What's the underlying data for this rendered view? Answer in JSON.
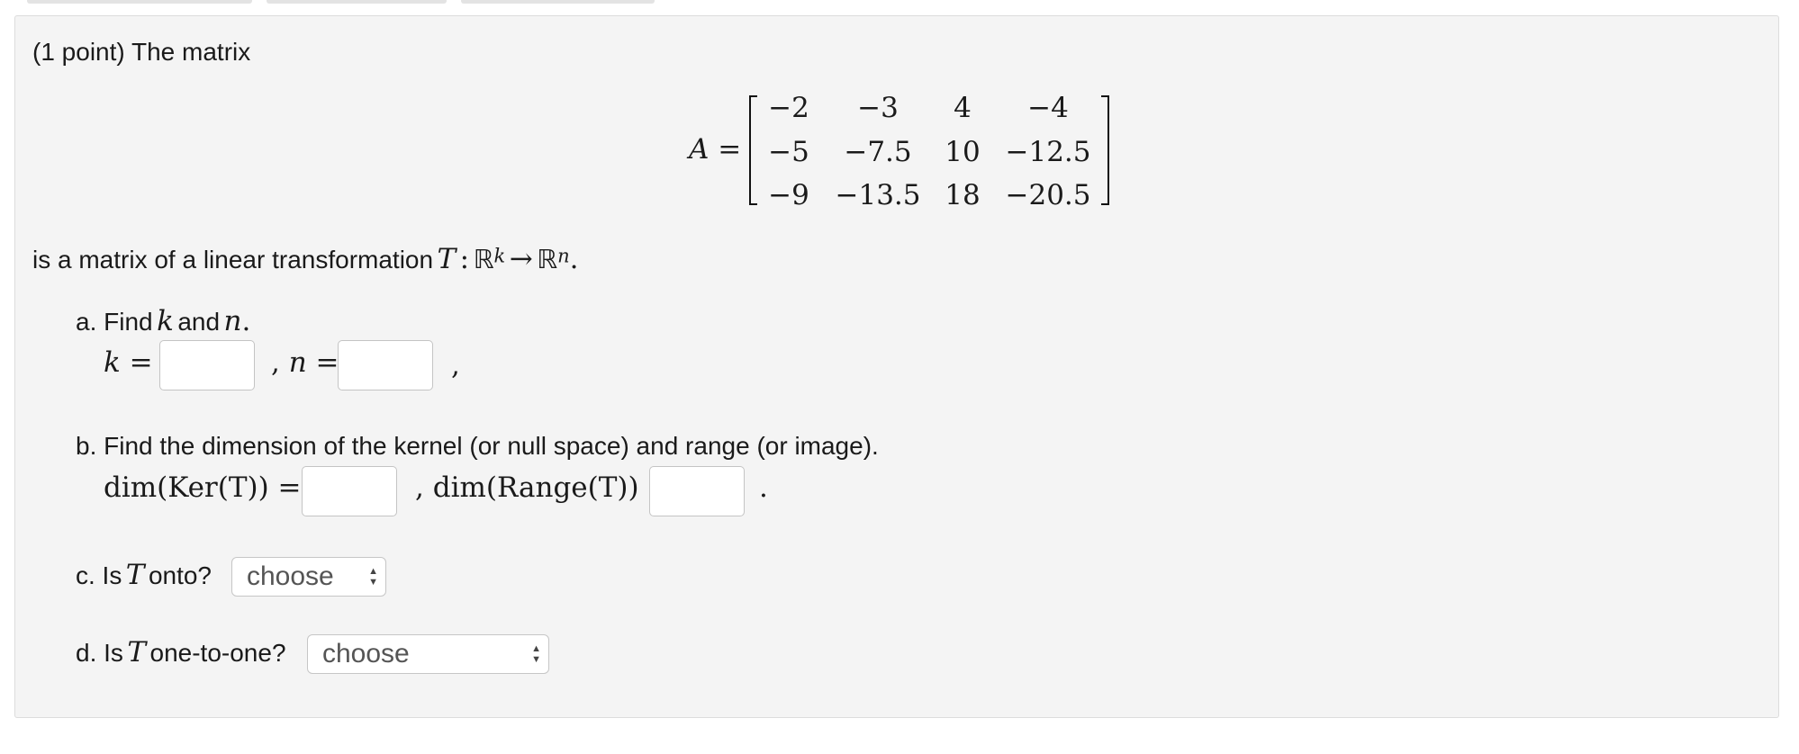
{
  "problem": {
    "intro": "(1 point) The matrix",
    "matrix_lhs": "A =",
    "matrix": [
      [
        "−2",
        "−3",
        "4",
        "−4"
      ],
      [
        "−5",
        "−7.5",
        "10",
        "−12.5"
      ],
      [
        "−9",
        "−13.5",
        "18",
        "−20.5"
      ]
    ],
    "statement_prefix": "is a matrix of a linear transformation",
    "statement_math": {
      "T": "T",
      "colon": ":",
      "R": "ℝ",
      "k": "k",
      "arrow": "→",
      "n": "n",
      "period": "."
    }
  },
  "part_a": {
    "label": "a. Find",
    "k": "k",
    "and": "and",
    "n": "n",
    "period": ".",
    "k_eq": "k =",
    "sep": ",",
    "n_eq": "n =",
    "trail": ",",
    "k_value": "",
    "n_value": ""
  },
  "part_b": {
    "label": "b. Find the dimension of the kernel (or null space) and range (or image).",
    "ker_eq": "dim(Ker(T)) =",
    "sep": ",",
    "range_eq": "dim(Range(T)) =",
    "trail": ".",
    "ker_value": "",
    "range_value": ""
  },
  "part_c": {
    "label_pre": "c. Is",
    "T": "T",
    "label_post": "onto?",
    "select_value": "choose"
  },
  "part_d": {
    "label_pre": "d. Is",
    "T": "T",
    "label_post": "one-to-one?",
    "select_value": "choose"
  }
}
